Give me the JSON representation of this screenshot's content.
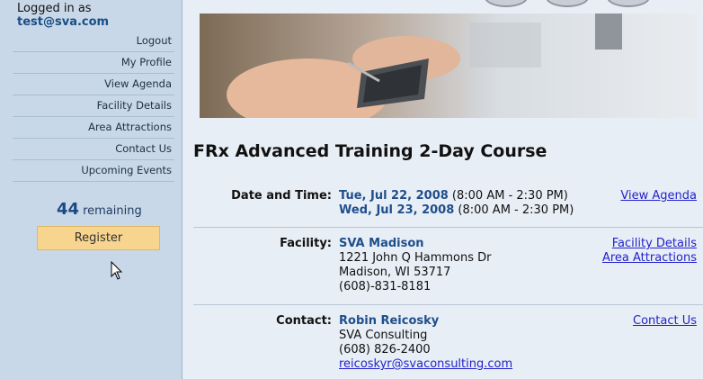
{
  "sidebar": {
    "login_label": "Logged in as",
    "login_user": "test@sva.com",
    "nav": [
      "Logout",
      "My Profile",
      "View Agenda",
      "Facility Details",
      "Area Attractions",
      "Contact Us",
      "Upcoming Events"
    ],
    "remaining_count": "44",
    "remaining_label": "remaining",
    "register_label": "Register"
  },
  "main": {
    "title": "FRx Advanced Training 2-Day Course",
    "date": {
      "label": "Date and Time:",
      "day1": "Tue, Jul 22, 2008",
      "day1_time": " (8:00 AM - 2:30 PM)",
      "day2": "Wed, Jul 23, 2008",
      "day2_time": " (8:00 AM - 2:30 PM)",
      "link": "View Agenda"
    },
    "facility": {
      "label": "Facility:",
      "name": "SVA Madison",
      "address1": "1221 John Q Hammons Dr",
      "address2": "Madison, WI 53717",
      "phone": "(608)-831-8181",
      "link1": "Facility Details",
      "link2": "Area Attractions"
    },
    "contact": {
      "label": "Contact:",
      "name": "Robin Reicosky",
      "company": "SVA Consulting",
      "phone": "(608) 826-2400",
      "email": "reicoskyr@svaconsulting.com",
      "link": "Contact Us"
    }
  },
  "colors": {
    "sidebar_bg": "#c9d8e8",
    "accent": "#1f4e8c",
    "register_bg": "#f7d58e",
    "link": "#2222cc"
  }
}
